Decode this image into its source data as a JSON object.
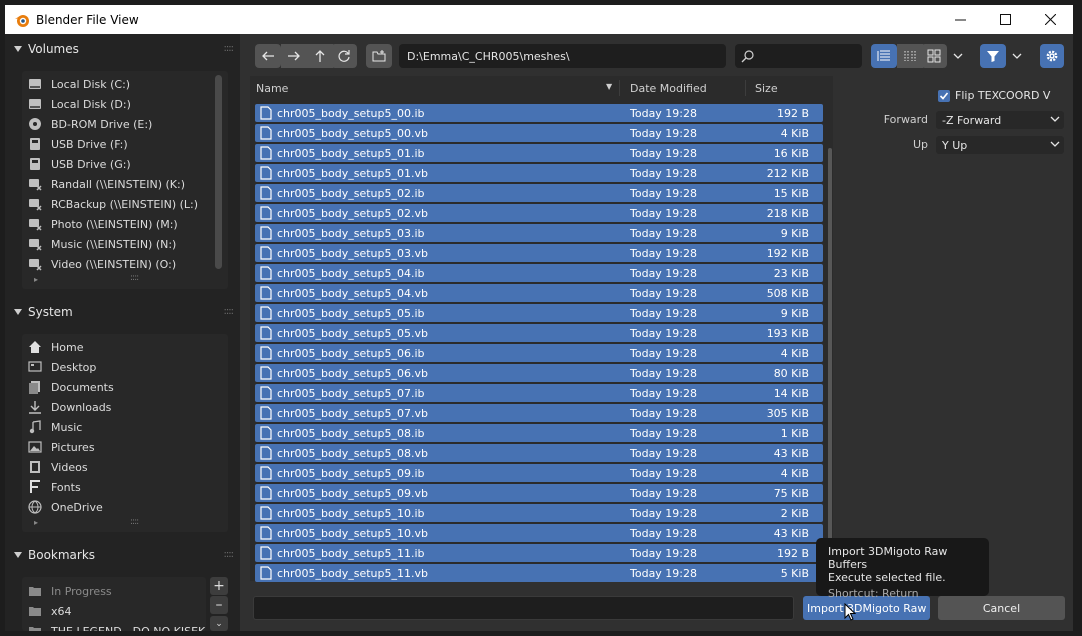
{
  "window": {
    "title": "Blender File View"
  },
  "colors": {
    "accent": "#4772b3",
    "background": "#303030",
    "sidebar": "#232323"
  },
  "sidebar": {
    "volumes": {
      "title": "Volumes",
      "items": [
        {
          "label": "Local Disk (C:)",
          "icon": "disk-icon"
        },
        {
          "label": "Local Disk (D:)",
          "icon": "disk-icon"
        },
        {
          "label": "BD-ROM Drive (E:)",
          "icon": "disc-icon"
        },
        {
          "label": "USB Drive (F:)",
          "icon": "usb-icon"
        },
        {
          "label": "USB Drive (G:)",
          "icon": "usb-icon"
        },
        {
          "label": "Randall (\\\\EINSTEIN) (K:)",
          "icon": "network-drive-icon"
        },
        {
          "label": "RCBackup (\\\\EINSTEIN) (L:)",
          "icon": "network-drive-icon"
        },
        {
          "label": "Photo (\\\\EINSTEIN) (M:)",
          "icon": "network-drive-icon"
        },
        {
          "label": "Music (\\\\EINSTEIN) (N:)",
          "icon": "network-drive-icon"
        },
        {
          "label": "Video (\\\\EINSTEIN) (O:)",
          "icon": "network-drive-icon"
        }
      ]
    },
    "system": {
      "title": "System",
      "items": [
        {
          "label": "Home",
          "icon": "home-icon"
        },
        {
          "label": "Desktop",
          "icon": "desktop-icon"
        },
        {
          "label": "Documents",
          "icon": "documents-icon"
        },
        {
          "label": "Downloads",
          "icon": "download-icon"
        },
        {
          "label": "Music",
          "icon": "music-icon"
        },
        {
          "label": "Pictures",
          "icon": "image-icon"
        },
        {
          "label": "Videos",
          "icon": "video-icon"
        },
        {
          "label": "Fonts",
          "icon": "font-icon"
        },
        {
          "label": "OneDrive",
          "icon": "globe-icon"
        }
      ]
    },
    "bookmarks": {
      "title": "Bookmarks",
      "items": [
        {
          "label": "In Progress",
          "icon": "folder-icon"
        },
        {
          "label": "x64",
          "icon": "folder-icon"
        },
        {
          "label": "THE LEGEND - DO NO KISEKI",
          "icon": "folder-icon"
        }
      ]
    }
  },
  "toolbar": {
    "path": "D:\\Emma\\C_CHR005\\meshes\\",
    "search_placeholder": ""
  },
  "columns": {
    "name": "Name",
    "date": "Date Modified",
    "size": "Size"
  },
  "files": [
    {
      "name": "chr005_body_setup5_00.ib",
      "date": "Today 19:28",
      "size": "192 B"
    },
    {
      "name": "chr005_body_setup5_00.vb",
      "date": "Today 19:28",
      "size": "4 KiB"
    },
    {
      "name": "chr005_body_setup5_01.ib",
      "date": "Today 19:28",
      "size": "16 KiB"
    },
    {
      "name": "chr005_body_setup5_01.vb",
      "date": "Today 19:28",
      "size": "212 KiB"
    },
    {
      "name": "chr005_body_setup5_02.ib",
      "date": "Today 19:28",
      "size": "15 KiB"
    },
    {
      "name": "chr005_body_setup5_02.vb",
      "date": "Today 19:28",
      "size": "218 KiB"
    },
    {
      "name": "chr005_body_setup5_03.ib",
      "date": "Today 19:28",
      "size": "9 KiB"
    },
    {
      "name": "chr005_body_setup5_03.vb",
      "date": "Today 19:28",
      "size": "192 KiB"
    },
    {
      "name": "chr005_body_setup5_04.ib",
      "date": "Today 19:28",
      "size": "23 KiB"
    },
    {
      "name": "chr005_body_setup5_04.vb",
      "date": "Today 19:28",
      "size": "508 KiB"
    },
    {
      "name": "chr005_body_setup5_05.ib",
      "date": "Today 19:28",
      "size": "9 KiB"
    },
    {
      "name": "chr005_body_setup5_05.vb",
      "date": "Today 19:28",
      "size": "193 KiB"
    },
    {
      "name": "chr005_body_setup5_06.ib",
      "date": "Today 19:28",
      "size": "4 KiB"
    },
    {
      "name": "chr005_body_setup5_06.vb",
      "date": "Today 19:28",
      "size": "80 KiB"
    },
    {
      "name": "chr005_body_setup5_07.ib",
      "date": "Today 19:28",
      "size": "14 KiB"
    },
    {
      "name": "chr005_body_setup5_07.vb",
      "date": "Today 19:28",
      "size": "305 KiB"
    },
    {
      "name": "chr005_body_setup5_08.ib",
      "date": "Today 19:28",
      "size": "1 KiB"
    },
    {
      "name": "chr005_body_setup5_08.vb",
      "date": "Today 19:28",
      "size": "43 KiB"
    },
    {
      "name": "chr005_body_setup5_09.ib",
      "date": "Today 19:28",
      "size": "4 KiB"
    },
    {
      "name": "chr005_body_setup5_09.vb",
      "date": "Today 19:28",
      "size": "75 KiB"
    },
    {
      "name": "chr005_body_setup5_10.ib",
      "date": "Today 19:28",
      "size": "2 KiB"
    },
    {
      "name": "chr005_body_setup5_10.vb",
      "date": "Today 19:28",
      "size": "43 KiB"
    },
    {
      "name": "chr005_body_setup5_11.ib",
      "date": "Today 19:28",
      "size": "192 B"
    },
    {
      "name": "chr005_body_setup5_11.vb",
      "date": "Today 19:28",
      "size": "5 KiB"
    }
  ],
  "options": {
    "flip_label": "Flip TEXCOORD V",
    "flip_checked": true,
    "forward_label": "Forward",
    "forward_value": "-Z Forward",
    "up_label": "Up",
    "up_value": "Y Up"
  },
  "footer": {
    "filename_value": "",
    "import_label": "Import 3DMigoto Raw ...",
    "cancel_label": "Cancel"
  },
  "tooltip": {
    "line1": "Import 3DMigoto Raw Buffers",
    "line2": "Execute selected file.",
    "line3": "Shortcut: Return"
  }
}
